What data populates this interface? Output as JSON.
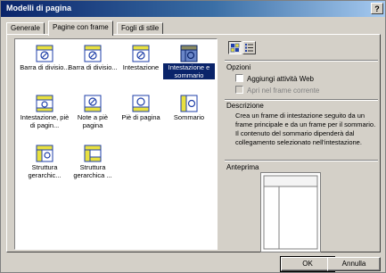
{
  "window": {
    "title": "Modelli di pagina",
    "help": "?"
  },
  "tabs": [
    {
      "label": "Generale"
    },
    {
      "label": "Pagine con frame"
    },
    {
      "label": "Fogli di stile"
    }
  ],
  "templates": [
    {
      "label": "Barra di divisio..."
    },
    {
      "label": "Barra di divisio..."
    },
    {
      "label": "Intestazione"
    },
    {
      "label": "Intestazione e sommario"
    },
    {
      "label": "Intestazione, piè di pagin..."
    },
    {
      "label": "Note a piè pagina"
    },
    {
      "label": "Piè di pagina"
    },
    {
      "label": "Sommario"
    },
    {
      "label": "Struttura gerarchic..."
    },
    {
      "label": "Struttura gerarchica ..."
    }
  ],
  "options": {
    "title": "Opzioni",
    "add_web": "Aggiungi attività Web",
    "open_frame": "Apri nel frame corrente"
  },
  "description": {
    "title": "Descrizione",
    "text": "Crea un frame di intestazione seguito da un frame principale e da un frame per il sommario. Il contenuto del sommario dipenderà dal collegamento selezionato nell'intestazione."
  },
  "preview": {
    "title": "Anteprima"
  },
  "buttons": {
    "ok": "OK",
    "cancel": "Annulla"
  }
}
